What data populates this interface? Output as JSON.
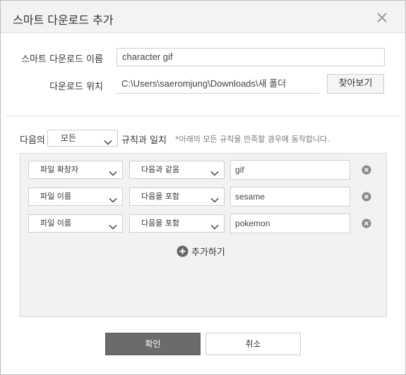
{
  "dialog": {
    "title": "스마트 다운로드 추가",
    "close_icon": "close-icon"
  },
  "form": {
    "name_label": "스마트 다운로드 이름",
    "name_value": "character gif",
    "location_label": "다운로드 위치",
    "location_value": "C:\\Users\\saeromjung\\Downloads\\새 폴더",
    "browse_label": "찾아보기"
  },
  "match": {
    "prefix": "다음의",
    "selected": "모든",
    "suffix": "규칙과 일치",
    "note": "*아래의 모든 규칙을 만족할 경우에 동작합니다."
  },
  "rules": [
    {
      "field": "파일 확장자",
      "condition": "다음과 같음",
      "value": "gif"
    },
    {
      "field": "파일 이름",
      "condition": "다음을 포함",
      "value": "sesame"
    },
    {
      "field": "파일 이름",
      "condition": "다음을 포함",
      "value": "pokemon"
    }
  ],
  "add_rule_label": "추가하기",
  "buttons": {
    "ok": "확인",
    "cancel": "취소"
  },
  "colors": {
    "ok_button": "#6b6b6b",
    "title_bar": "#f3f3f3",
    "rules_panel": "#f3f2f0"
  }
}
